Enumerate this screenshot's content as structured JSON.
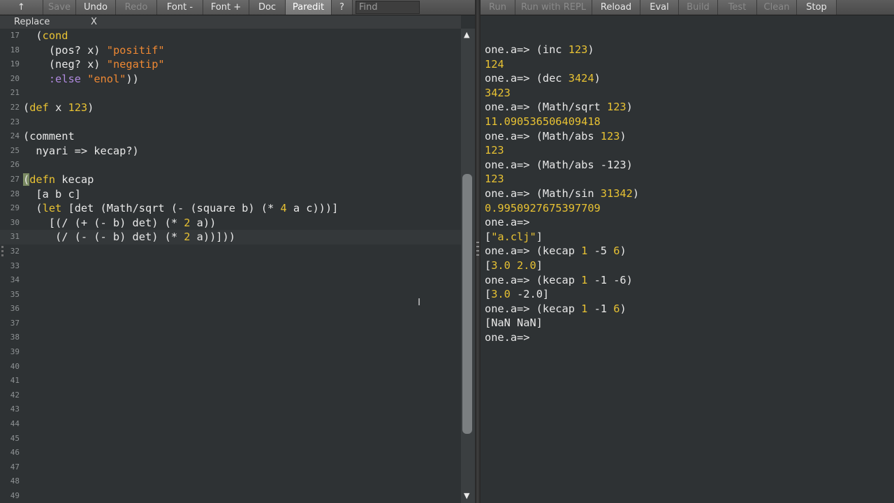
{
  "left_toolbar": {
    "buttons": [
      {
        "label": "↑",
        "disabled": false,
        "active": false
      },
      {
        "label": "Save",
        "disabled": true,
        "active": false
      },
      {
        "label": "Undo",
        "disabled": false,
        "active": false
      },
      {
        "label": "Redo",
        "disabled": true,
        "active": false
      },
      {
        "label": "Font -",
        "disabled": false,
        "active": false
      },
      {
        "label": "Font +",
        "disabled": false,
        "active": false
      },
      {
        "label": "Doc",
        "disabled": false,
        "active": false
      },
      {
        "label": "Paredit",
        "disabled": false,
        "active": true
      },
      {
        "label": "?",
        "disabled": false,
        "active": false
      }
    ],
    "find_placeholder": "Find"
  },
  "replace_bar": {
    "label": "Replace",
    "close": "X"
  },
  "editor": {
    "lines": [
      {
        "n": "17",
        "segs": [
          [
            "p",
            "  ("
          ],
          [
            "kw",
            "cond"
          ]
        ]
      },
      {
        "n": "18",
        "segs": [
          [
            "p",
            "    (pos? x) "
          ],
          [
            "str",
            "\"positif\""
          ]
        ]
      },
      {
        "n": "19",
        "segs": [
          [
            "p",
            "    (neg? x) "
          ],
          [
            "str",
            "\"negatip\""
          ]
        ]
      },
      {
        "n": "20",
        "segs": [
          [
            "p",
            "    "
          ],
          [
            "kwd",
            ":else"
          ],
          [
            "p",
            " "
          ],
          [
            "str",
            "\"enol\""
          ],
          [
            "p",
            "))"
          ]
        ]
      },
      {
        "n": "21",
        "segs": []
      },
      {
        "n": "22",
        "segs": [
          [
            "p",
            "("
          ],
          [
            "kw",
            "def"
          ],
          [
            "p",
            " x "
          ],
          [
            "num",
            "123"
          ],
          [
            "p",
            ")"
          ]
        ]
      },
      {
        "n": "23",
        "segs": []
      },
      {
        "n": "24",
        "segs": [
          [
            "p",
            "(comment"
          ]
        ]
      },
      {
        "n": "25",
        "segs": [
          [
            "p",
            "  nyari => kecap?)"
          ]
        ]
      },
      {
        "n": "26",
        "segs": []
      },
      {
        "n": "27",
        "segs": [
          [
            "hl",
            "("
          ],
          [
            "kw",
            "defn"
          ],
          [
            "p",
            " kecap"
          ]
        ]
      },
      {
        "n": "28",
        "segs": [
          [
            "p",
            "  [a b c]"
          ]
        ]
      },
      {
        "n": "29",
        "segs": [
          [
            "p",
            "  ("
          ],
          [
            "kw",
            "let"
          ],
          [
            "p",
            " [det (Math/sqrt (- (square b) (* "
          ],
          [
            "num",
            "4"
          ],
          [
            "p",
            " a c)))]"
          ]
        ]
      },
      {
        "n": "30",
        "segs": [
          [
            "p",
            "    [(/ (+ (- b) det) (* "
          ],
          [
            "num",
            "2"
          ],
          [
            "p",
            " a))"
          ]
        ]
      },
      {
        "n": "31",
        "segs": [
          [
            "p",
            "     (/ (- (- b) det) (* "
          ],
          [
            "num",
            "2"
          ],
          [
            "p",
            " a))]))"
          ]
        ],
        "current": true
      },
      {
        "n": "32",
        "segs": []
      },
      {
        "n": "33",
        "segs": []
      },
      {
        "n": "34",
        "segs": []
      },
      {
        "n": "35",
        "segs": []
      },
      {
        "n": "36",
        "segs": []
      },
      {
        "n": "37",
        "segs": []
      },
      {
        "n": "38",
        "segs": []
      },
      {
        "n": "39",
        "segs": []
      },
      {
        "n": "40",
        "segs": []
      },
      {
        "n": "41",
        "segs": []
      },
      {
        "n": "42",
        "segs": []
      },
      {
        "n": "43",
        "segs": []
      },
      {
        "n": "44",
        "segs": []
      },
      {
        "n": "45",
        "segs": []
      },
      {
        "n": "46",
        "segs": []
      },
      {
        "n": "47",
        "segs": []
      },
      {
        "n": "48",
        "segs": []
      },
      {
        "n": "49",
        "segs": []
      }
    ]
  },
  "right_toolbar": {
    "buttons": [
      {
        "label": "Run",
        "disabled": true
      },
      {
        "label": "Run with REPL",
        "disabled": true
      },
      {
        "label": "Reload",
        "disabled": false
      },
      {
        "label": "Eval",
        "disabled": false
      },
      {
        "label": "Build",
        "disabled": true
      },
      {
        "label": "Test",
        "disabled": true
      },
      {
        "label": "Clean",
        "disabled": true
      },
      {
        "label": "Stop",
        "disabled": false
      }
    ]
  },
  "repl": {
    "lines": [
      {
        "segs": [
          [
            "p",
            "one.a=> (inc "
          ],
          [
            "o",
            "123"
          ],
          [
            "p",
            ")"
          ]
        ]
      },
      {
        "segs": [
          [
            "o",
            "124"
          ]
        ]
      },
      {
        "segs": [
          [
            "p",
            "one.a=> (dec "
          ],
          [
            "o",
            "3424"
          ],
          [
            "p",
            ")"
          ]
        ]
      },
      {
        "segs": [
          [
            "o",
            "3423"
          ]
        ]
      },
      {
        "segs": [
          [
            "p",
            "one.a=> (Math/sqrt "
          ],
          [
            "o",
            "123"
          ],
          [
            "p",
            ")"
          ]
        ]
      },
      {
        "segs": [
          [
            "o",
            "11.090536506409418"
          ]
        ]
      },
      {
        "segs": [
          [
            "p",
            "one.a=> (Math/abs "
          ],
          [
            "o",
            "123"
          ],
          [
            "p",
            ")"
          ]
        ]
      },
      {
        "segs": [
          [
            "o",
            "123"
          ]
        ]
      },
      {
        "segs": [
          [
            "p",
            "one.a=> (Math/abs -123)"
          ]
        ]
      },
      {
        "segs": [
          [
            "o",
            "123"
          ]
        ]
      },
      {
        "segs": [
          [
            "p",
            "one.a=> (Math/sin "
          ],
          [
            "o",
            "31342"
          ],
          [
            "p",
            ")"
          ]
        ]
      },
      {
        "segs": [
          [
            "o",
            "0.9950927675397709"
          ]
        ]
      },
      {
        "segs": [
          [
            "p",
            "one.a=>"
          ]
        ]
      },
      {
        "segs": [
          [
            "p",
            "["
          ],
          [
            "o",
            "\"a.clj\""
          ],
          [
            "p",
            "]"
          ]
        ]
      },
      {
        "segs": [
          [
            "p",
            "one.a=> (kecap "
          ],
          [
            "o",
            "1"
          ],
          [
            "p",
            " -5 "
          ],
          [
            "o",
            "6"
          ],
          [
            "p",
            ")"
          ]
        ]
      },
      {
        "segs": [
          [
            "p",
            "["
          ],
          [
            "o",
            "3.0 2.0"
          ],
          [
            "p",
            "]"
          ]
        ]
      },
      {
        "segs": [
          [
            "p",
            "one.a=> (kecap "
          ],
          [
            "o",
            "1"
          ],
          [
            "p",
            " -1 -6)"
          ]
        ]
      },
      {
        "segs": [
          [
            "p",
            "["
          ],
          [
            "o",
            "3.0"
          ],
          [
            "p",
            " -2.0]"
          ]
        ]
      },
      {
        "segs": [
          [
            "p",
            "one.a=> (kecap "
          ],
          [
            "o",
            "1"
          ],
          [
            "p",
            " -1 "
          ],
          [
            "o",
            "6"
          ],
          [
            "p",
            ")"
          ]
        ]
      },
      {
        "segs": [
          [
            "p",
            "[NaN NaN]"
          ]
        ]
      },
      {
        "segs": [
          [
            "p",
            "one.a=>"
          ]
        ]
      }
    ]
  }
}
